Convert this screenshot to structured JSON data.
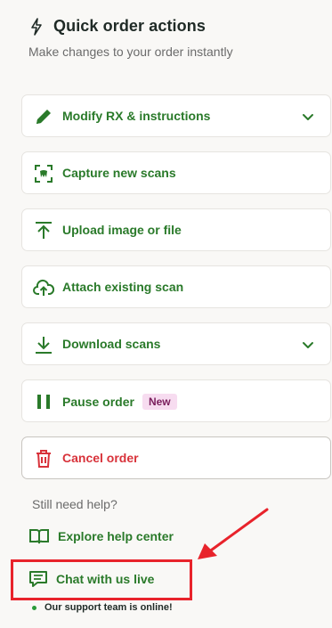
{
  "header": {
    "title": "Quick order actions",
    "subtitle": "Make changes to your order instantly"
  },
  "actions": [
    {
      "label": "Modify RX & instructions",
      "icon": "pencil-icon",
      "expandable": true
    },
    {
      "label": "Capture new scans",
      "icon": "scan-icon",
      "expandable": false
    },
    {
      "label": "Upload image or file",
      "icon": "upload-icon",
      "expandable": false
    },
    {
      "label": "Attach existing scan",
      "icon": "cloud-upload-icon",
      "expandable": false
    },
    {
      "label": "Download scans",
      "icon": "download-icon",
      "expandable": true
    },
    {
      "label": "Pause order",
      "icon": "pause-icon",
      "badge": "New",
      "expandable": false
    },
    {
      "label": "Cancel order",
      "icon": "trash-icon",
      "expandable": false
    }
  ],
  "help": {
    "heading": "Still need help?",
    "explore_label": "Explore help center",
    "chat_label": "Chat with us live",
    "online_status": "Our support team is online!"
  },
  "colors": {
    "accent_green": "#2a7a2a",
    "danger_red": "#d8323a",
    "highlight_red": "#e8232b",
    "badge_bg": "#f7dcf0"
  }
}
